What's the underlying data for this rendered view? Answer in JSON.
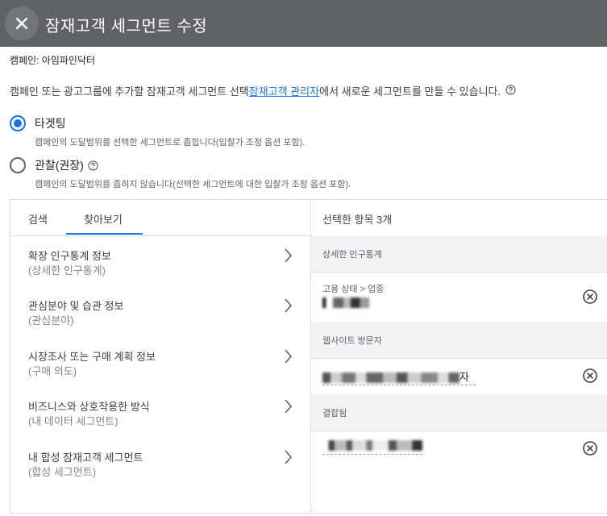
{
  "header": {
    "title": "잠재고객 세그먼트 수정"
  },
  "campaign_line": "캠페인: 아임파인닥터",
  "description": {
    "before_link": "캠페인 또는 광고그룹에 추가할 잠재고객 세그먼트 선택",
    "link": "잠재고객 관리자",
    "after_link": "에서 새로운 세그먼트를 만들 수 있습니다."
  },
  "options": [
    {
      "label": "타겟팅",
      "description": "캠페인의 도달범위를 선택한 세그먼트로 좁힙니다(입찰가 조정 옵션 포함).",
      "selected": true
    },
    {
      "label": "관찰(권장)",
      "description": "캠페인의 도달범위를 좁히지 않습니다(선택한 세그먼트에 대한 입찰가 조정 옵션 포함).",
      "selected": false
    }
  ],
  "tabs": [
    {
      "label": "검색",
      "active": false
    },
    {
      "label": "찾아보기",
      "active": true
    }
  ],
  "categories": [
    {
      "title": "확장 인구통계 정보",
      "subtitle": "(상세한 인구통계)"
    },
    {
      "title": "관심분야 및 습관 정보",
      "subtitle": "(관심분야)"
    },
    {
      "title": "시장조사 또는 구매 계획 정보",
      "subtitle": "(구매 의도)"
    },
    {
      "title": "비즈니스와 상호작용한 방식",
      "subtitle": "(내 데이터 세그먼트)"
    },
    {
      "title": "내 합성 잠재고객 세그먼트",
      "subtitle": "(합성 세그먼트)"
    }
  ],
  "selected": {
    "header": "선택한 항목 3개",
    "groups": [
      {
        "label": "상세한 인구통계",
        "path": "고용 상태 > 업종",
        "name_suffix": ""
      },
      {
        "label": "웹사이트 방문자",
        "path": "",
        "name_suffix": "자"
      },
      {
        "label": "결합됨",
        "path": "",
        "name_suffix": ""
      }
    ]
  },
  "colors": {
    "header_bg": "#5f6368",
    "accent": "#1a73e8",
    "link": "#1a73e8"
  },
  "icons": {
    "close": "close-icon",
    "help": "help-circle-icon",
    "chevron": "chevron-right-icon",
    "remove": "remove-circle-icon"
  }
}
